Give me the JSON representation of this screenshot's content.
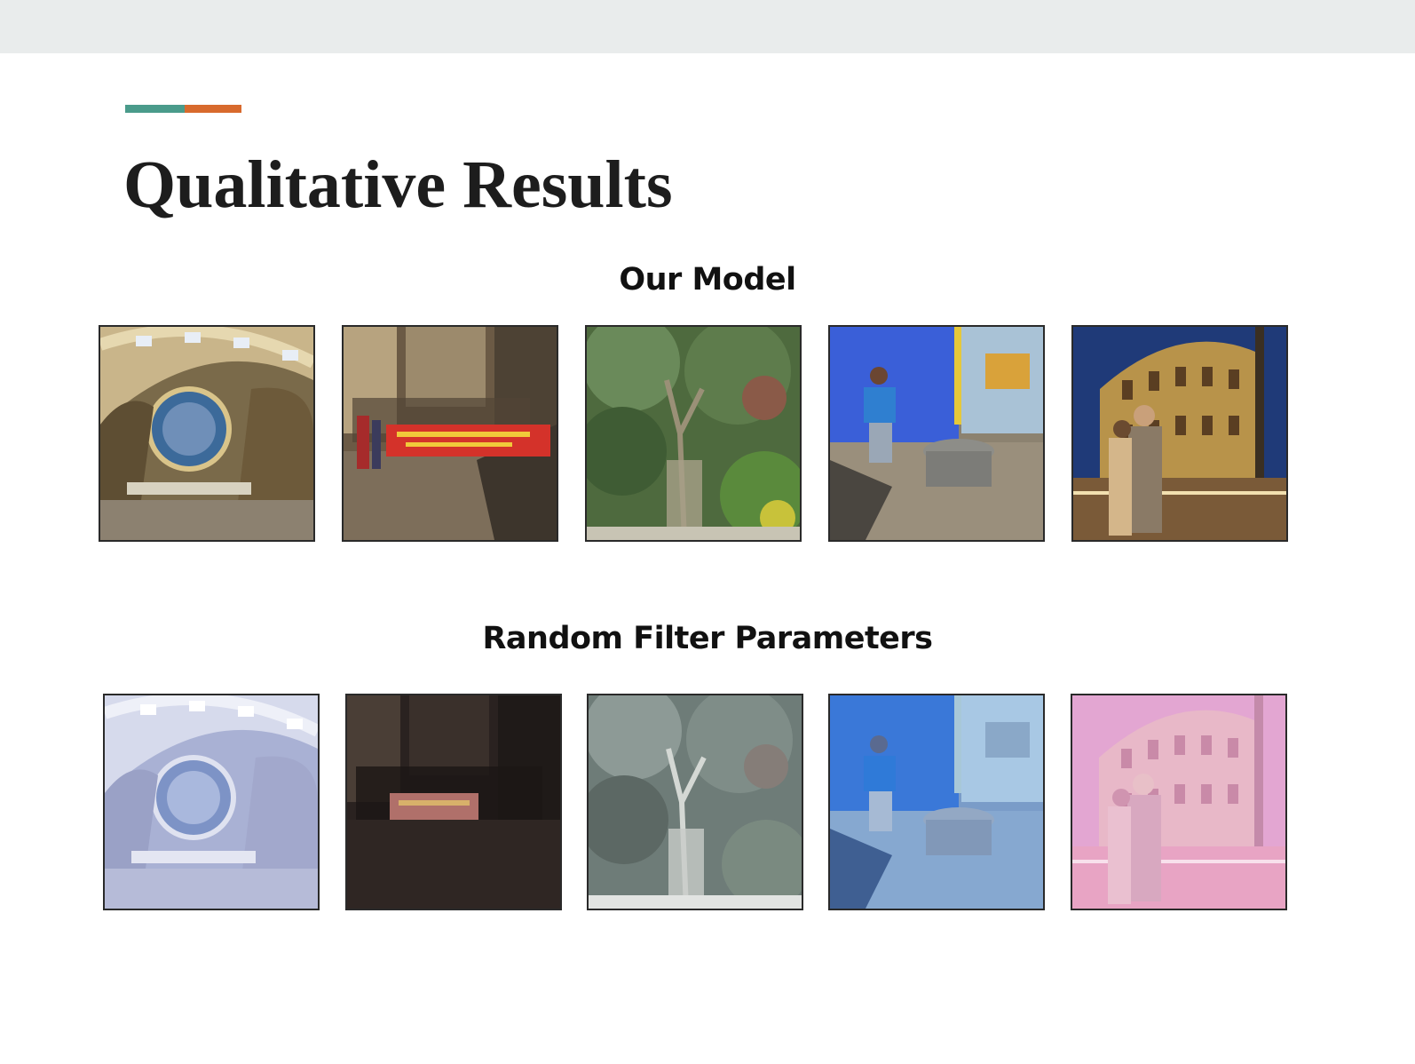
{
  "slide": {
    "title": "Qualitative Results",
    "accent_colors": [
      "#4a9b8b",
      "#d86a2d"
    ]
  },
  "sections": [
    {
      "heading": "Our Model",
      "images": [
        {
          "subject": "dome-interior",
          "tint": "natural"
        },
        {
          "subject": "street-protest-banner",
          "tint": "natural"
        },
        {
          "subject": "forest-trees",
          "tint": "natural"
        },
        {
          "subject": "man-by-blue-wall",
          "tint": "natural"
        },
        {
          "subject": "colosseum-couple",
          "tint": "natural"
        }
      ]
    },
    {
      "heading": "Random Filter Parameters",
      "images": [
        {
          "subject": "dome-interior",
          "tint": "washed-blue"
        },
        {
          "subject": "street-protest-banner",
          "tint": "very-dark"
        },
        {
          "subject": "forest-trees",
          "tint": "desaturated"
        },
        {
          "subject": "man-by-blue-wall",
          "tint": "blue"
        },
        {
          "subject": "colosseum-couple",
          "tint": "pink"
        }
      ]
    }
  ]
}
